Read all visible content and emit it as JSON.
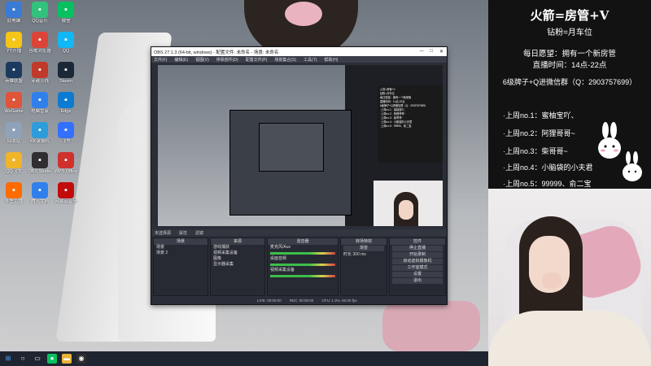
{
  "desktop": {
    "icons": [
      {
        "label": "此电脑",
        "icon": "computer-icon",
        "color": "#3a7bd5"
      },
      {
        "label": "YY开播",
        "icon": "yy-icon",
        "color": "#f5c518"
      },
      {
        "label": "英雄联盟",
        "icon": "lol-icon",
        "color": "#1b3a5e"
      },
      {
        "label": "WeGame",
        "icon": "wegame-icon",
        "color": "#e0543a"
      },
      {
        "label": "回收站",
        "icon": "recycle-bin-icon",
        "color": "#8fa3b8"
      },
      {
        "label": "QQ飞车",
        "icon": "qqspeed-icon",
        "color": "#f0b429"
      },
      {
        "label": "斗鱼直播",
        "icon": "douyu-icon",
        "color": "#ff6b00"
      },
      {
        "label": "QQ音乐",
        "icon": "qqmusic-icon",
        "color": "#31c27c"
      },
      {
        "label": "谷歌浏览器",
        "icon": "chrome-icon",
        "color": "#db4437"
      },
      {
        "label": "穿越火线",
        "icon": "cf-icon",
        "color": "#c0392b"
      },
      {
        "label": "电脑管家",
        "icon": "pcmgr-icon",
        "color": "#2f80ed"
      },
      {
        "label": "KK录像机",
        "icon": "kk-icon",
        "color": "#2d9cdb"
      },
      {
        "label": "OBS Studio",
        "icon": "obs-icon",
        "color": "#302e31"
      },
      {
        "label": "腾讯文档",
        "icon": "docs-icon",
        "color": "#2f80ed"
      },
      {
        "label": "微信",
        "icon": "wechat-icon",
        "color": "#07c160"
      },
      {
        "label": "QQ",
        "icon": "qq-icon",
        "color": "#12b7f5"
      },
      {
        "label": "Steam",
        "icon": "steam-icon",
        "color": "#1b2838"
      },
      {
        "label": "Edge",
        "icon": "edge-icon",
        "color": "#0c7bd1"
      },
      {
        "label": "飞书",
        "icon": "feishu-icon",
        "color": "#3370ff"
      },
      {
        "label": "WPS Office",
        "icon": "wps-icon",
        "color": "#d0312d"
      },
      {
        "label": "网易云音乐",
        "icon": "netease-icon",
        "color": "#c20c0c"
      }
    ]
  },
  "taskbar": {
    "items": [
      "start",
      "search",
      "taskview",
      "wechat",
      "explorer",
      "obs"
    ]
  },
  "obs": {
    "title": "OBS 27.1.3 (64-bit, windows) - 配置文件: 未命名 - 场景: 未命名",
    "menu": [
      "文件(F)",
      "编辑(E)",
      "视图(V)",
      "停靠部件(D)",
      "配置文件(P)",
      "场景集合(S)",
      "工具(T)",
      "帮助(H)"
    ],
    "controls_bar": [
      "未选择源",
      "属性",
      "滤镜"
    ],
    "docks": {
      "scenes": {
        "title": "场景",
        "items": [
          "场景",
          "场景 2"
        ]
      },
      "sources": {
        "title": "来源",
        "items": [
          "游戏捕获",
          "视频采集设备",
          "图像",
          "显示器采集"
        ]
      },
      "mixer": {
        "title": "混音器",
        "items": [
          "麦克风/Aux",
          "桌面音频",
          "视频采集设备"
        ]
      },
      "transitions": {
        "title": "转场特效",
        "items": [
          "渐变",
          "时长 300 ms"
        ]
      },
      "controls": {
        "title": "控件",
        "items": [
          "停止直播",
          "开始录制",
          "启动虚拟摄像机",
          "工作室模式",
          "设置",
          "退出"
        ]
      }
    },
    "status": [
      "LIVE: 00:00:00",
      "REC: 00:00:00",
      "CPU: 1.3%, 60.00 fps"
    ]
  },
  "sign": {
    "title": "火箭=房管+V",
    "subtitle": "钻粉=月车位",
    "wish": "每日愿望：拥有一个新房管",
    "hours": "直播时间：14点-22点",
    "contact": "6级牌子+Q进微信群（Q：2903757699）",
    "ranks": [
      "·上周no.1：蜜柚宝吖、",
      "·上周no.2：阿狸哥哥~",
      "·上周no.3：柴哥哥~",
      "·上周no.4：小脑袋的小夫君",
      "·上周no.5：99999、俞二宝"
    ]
  }
}
